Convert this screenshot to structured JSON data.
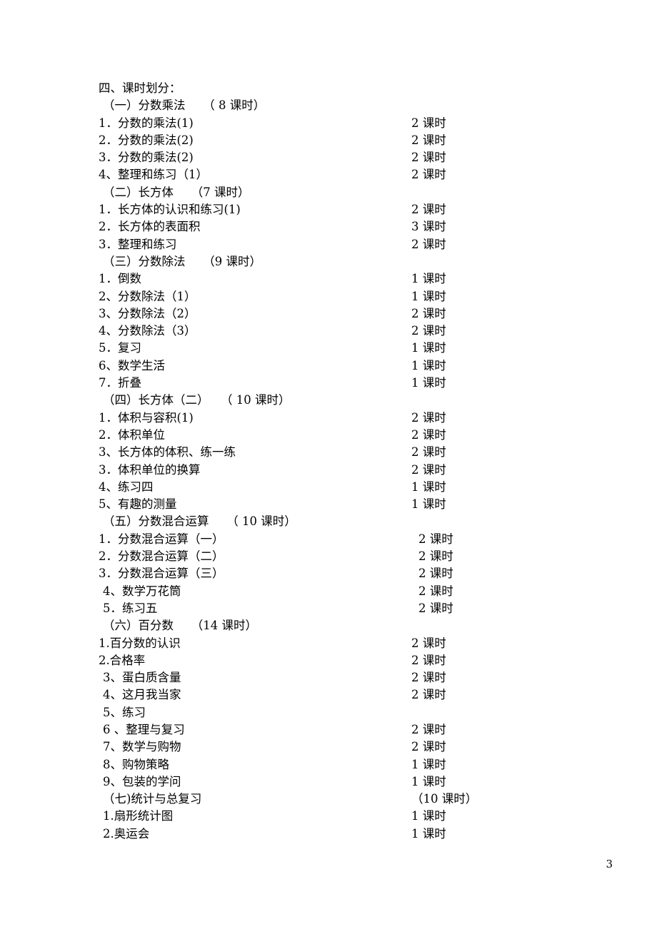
{
  "document": {
    "page_number": "3",
    "heading": "四、课时划分："
  },
  "lines": [
    {
      "label": "四、课时划分：",
      "value": "",
      "indent": 0,
      "value_x": 0
    },
    {
      "label": "（一）分数乘法　　（ 8 课时）",
      "value": "",
      "indent": 6,
      "value_x": 0
    },
    {
      "label": "1．分数的乘法(1)",
      "value": "2 课时",
      "indent": 0,
      "value_x": 438
    },
    {
      "label": "2．分数的乘法(2)",
      "value": "2 课时",
      "indent": 0,
      "value_x": 438
    },
    {
      "label": "3．分数的乘法(2)",
      "value": "2 课时",
      "indent": 0,
      "value_x": 438
    },
    {
      "label": "4、整理和练习（1）",
      "value": "2 课时",
      "indent": 0,
      "value_x": 438
    },
    {
      "label": "（二）长方体　　（7 课时）",
      "value": "",
      "indent": 6,
      "value_x": 0
    },
    {
      "label": "1．长方体的认识和练习(1)",
      "value": "2 课时",
      "indent": 0,
      "value_x": 438
    },
    {
      "label": "2．长方体的表面积",
      "value": "3 课时",
      "indent": 0,
      "value_x": 438
    },
    {
      "label": "3．整理和练习",
      "value": "2 课时",
      "indent": 0,
      "value_x": 438
    },
    {
      "label": "（三）分数除法　　（9 课时）",
      "value": "",
      "indent": 6,
      "value_x": 0
    },
    {
      "label": "1．倒数",
      "value": "1 课时",
      "indent": 0,
      "value_x": 438
    },
    {
      "label": "2、分数除法（1）",
      "value": "1 课时",
      "indent": 0,
      "value_x": 438
    },
    {
      "label": "3、分数除法（2）",
      "value": "2 课时",
      "indent": 0,
      "value_x": 438
    },
    {
      "label": "4、分数除法（3）",
      "value": "2 课时",
      "indent": 0,
      "value_x": 438
    },
    {
      "label": "5．复习",
      "value": "1 课时",
      "indent": 0,
      "value_x": 438
    },
    {
      "label": "6、数学生活",
      "value": "1 课时",
      "indent": 0,
      "value_x": 438
    },
    {
      "label": "7．折叠",
      "value": "1 课时",
      "indent": 0,
      "value_x": 438
    },
    {
      "label": "（四）长方体（二）　　（ 10 课时）",
      "value": "",
      "indent": 6,
      "value_x": 0
    },
    {
      "label": "1．体积与容积(1)",
      "value": "2 课时",
      "indent": 0,
      "value_x": 438
    },
    {
      "label": "2．体积单位",
      "value": "2 课时",
      "indent": 0,
      "value_x": 438
    },
    {
      "label": "3、长方体的体积、练一练",
      "value": "2 课时",
      "indent": 0,
      "value_x": 438
    },
    {
      "label": "3．体积单位的换算",
      "value": "2 课时",
      "indent": 0,
      "value_x": 438
    },
    {
      "label": "4、练习四",
      "value": "1 课时",
      "indent": 0,
      "value_x": 438
    },
    {
      "label": "5、有趣的测量",
      "value": "1 课时",
      "indent": 0,
      "value_x": 438
    },
    {
      "label": "（五）分数混合运算　　（ 10 课时）",
      "value": "",
      "indent": 6,
      "value_x": 0
    },
    {
      "label": "1．分数混合运算（一）",
      "value": "2 课时",
      "indent": 0,
      "value_x": 448
    },
    {
      "label": "2．分数混合运算（二）",
      "value": "2 课时",
      "indent": 0,
      "value_x": 448
    },
    {
      "label": "3．分数混合运算（三）",
      "value": "2 课时",
      "indent": 0,
      "value_x": 448
    },
    {
      "label": "4、数学万花筒",
      "value": "2 课时",
      "indent": 6,
      "value_x": 448
    },
    {
      "label": "5．练习五",
      "value": "2 课时",
      "indent": 6,
      "value_x": 448
    },
    {
      "label": "（六）百分数　　（14 课时）",
      "value": "",
      "indent": 6,
      "value_x": 0
    },
    {
      "label": "1.百分数的认识",
      "value": "2 课时",
      "indent": 0,
      "value_x": 438
    },
    {
      "label": "2.合格率",
      "value": "2 课时",
      "indent": 0,
      "value_x": 438
    },
    {
      "label": "3、蛋白质含量",
      "value": "2 课时",
      "indent": 6,
      "value_x": 438
    },
    {
      "label": "4、这月我当家",
      "value": "2 课时",
      "indent": 6,
      "value_x": 438
    },
    {
      "label": "5、练习",
      "value": "",
      "indent": 6,
      "value_x": 438
    },
    {
      "label": "6 、整理与复习",
      "value": "2 课时",
      "indent": 6,
      "value_x": 438
    },
    {
      "label": "7、数学与购物",
      "value": "2 课时",
      "indent": 6,
      "value_x": 438
    },
    {
      "label": "8、购物策略",
      "value": "1 课时",
      "indent": 6,
      "value_x": 438
    },
    {
      "label": "9、包装的学问",
      "value": "1 课时",
      "indent": 6,
      "value_x": 438
    },
    {
      "label": "（七)统计与总复习",
      "value": "（10 课时）",
      "indent": 6,
      "value_x": 438
    },
    {
      "label": "1.扇形统计图",
      "value": "1 课时",
      "indent": 6,
      "value_x": 438
    },
    {
      "label": "2.奥运会",
      "value": "1 课时",
      "indent": 6,
      "value_x": 438
    }
  ]
}
